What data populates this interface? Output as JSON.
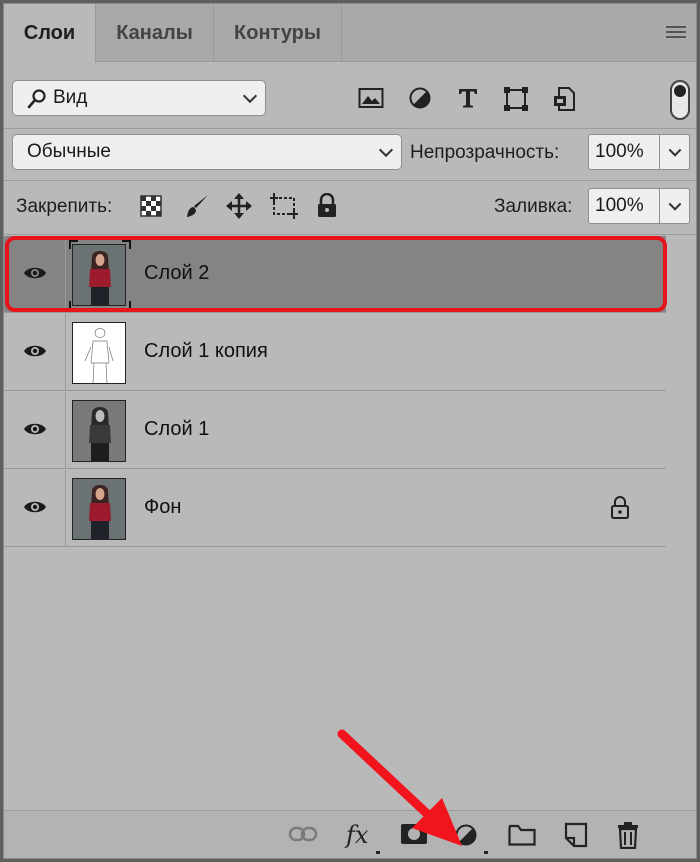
{
  "tabs": [
    {
      "label": "Слои",
      "active": true
    },
    {
      "label": "Каналы",
      "active": false
    },
    {
      "label": "Контуры",
      "active": false
    }
  ],
  "filter": {
    "label": "Вид",
    "icons": [
      "image-filter-icon",
      "adjustment-filter-icon",
      "type-filter-icon",
      "shape-filter-icon",
      "smart-object-filter-icon"
    ]
  },
  "blend": {
    "mode": "Обычные",
    "opacity_label": "Непрозрачность:",
    "opacity": "100%"
  },
  "lock": {
    "label": "Закрепить:",
    "fill_label": "Заливка:",
    "fill": "100%"
  },
  "layers": [
    {
      "name": "Слой 2",
      "selected": true,
      "locked": false
    },
    {
      "name": "Слой 1 копия",
      "selected": false,
      "locked": false
    },
    {
      "name": "Слой 1",
      "selected": false,
      "locked": false
    },
    {
      "name": "Фон",
      "selected": false,
      "locked": true
    }
  ],
  "bottom_icons": [
    "link-icon",
    "fx-icon",
    "mask-icon",
    "adjustment-icon",
    "folder-icon",
    "new-layer-icon",
    "trash-icon"
  ],
  "bottom_fx_text": "fx",
  "colors": {
    "panel": "#b9b9b9",
    "selected_row": "#848484",
    "highlight": "#e8141c",
    "arrow": "#f2141c"
  }
}
